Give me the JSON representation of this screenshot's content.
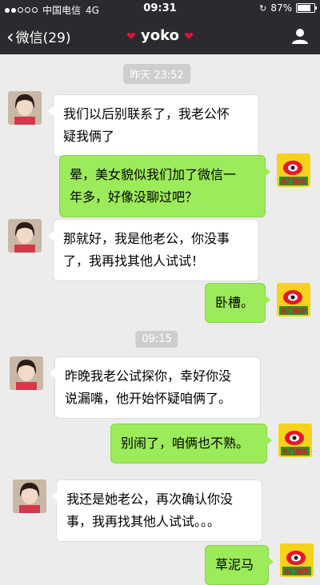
{
  "status_bar": {
    "carrier": "中国电信",
    "network": "4G",
    "time": "09:31",
    "battery": "87%",
    "battery_level": 0.87
  },
  "nav": {
    "back_label": "微信(29)",
    "title": "yoko",
    "title_decoration_icon": "lips-icon",
    "profile_icon": "person-icon"
  },
  "colors": {
    "bar_bg": "#2b2b2f",
    "chat_bg": "#ececec",
    "outgoing_bubble": "#9ceb5a",
    "incoming_bubble": "#ffffff",
    "timestamp_bg": "#cecece"
  },
  "messages": {
    "ts1": "昨天 23:52",
    "m1": [
      "我们以后别联系了，我老公怀",
      "疑我俩了"
    ],
    "m2": [
      "晕，美女貌似我们加了微信一",
      "年多，好像没聊过吧？"
    ],
    "m3": [
      "那就好，我是他老公，你没事",
      "了，我再找其他人试试！"
    ],
    "m4": [
      "卧槽。"
    ],
    "ts2": "09:15",
    "m5": [
      "昨晚我老公试探你，幸好你没",
      "说漏嘴，他开始怀疑咱俩了。"
    ],
    "m6": [
      "别闹了，咱俩也不熟。"
    ],
    "m7": [
      "我还是她老公，再次确认你没",
      "事，我再找其他人试试。。。"
    ],
    "m8": [
      "草泥马"
    ]
  },
  "self_avatar_text": "热门搞笑"
}
